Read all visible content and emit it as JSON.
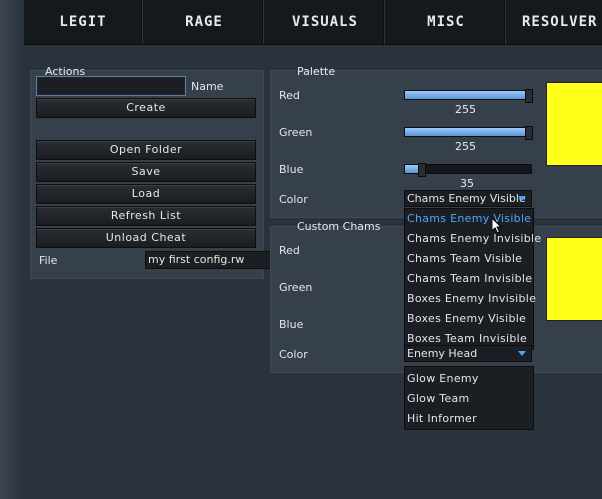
{
  "tabs": [
    "LEGIT",
    "RAGE",
    "VISUALS",
    "MISC",
    "RESOLVER"
  ],
  "actions": {
    "title": "Actions",
    "name_label": "Name",
    "name_value": "",
    "create": "Create",
    "open_folder": "Open Folder",
    "save": "Save",
    "load": "Load",
    "refresh_list": "Refresh List",
    "unload_cheat": "Unload Cheat",
    "file_label": "File",
    "file_value": "my first config.rw"
  },
  "palette": {
    "title": "Palette",
    "red_label": "Red",
    "red_value": "255",
    "red_level": 1.0,
    "green_label": "Green",
    "green_value": "255",
    "green_level": 1.0,
    "blue_label": "Blue",
    "blue_value": "35",
    "blue_level": 0.137,
    "color_label": "Color",
    "color_selected": "Chams Enemy Visible",
    "swatch_color": "#ffff1a",
    "dropdown_options": [
      "Chams Enemy Visible",
      "Chams Enemy Invisible",
      "Chams Team Visible",
      "Chams Team Invisible",
      "Boxes Enemy Invisible",
      "Boxes Enemy Visible",
      "Boxes Team Invisible",
      "Enemy Head",
      "Glow Enemy",
      "Glow Team",
      "Hit Informer"
    ]
  },
  "custom_chams": {
    "title": "Custom Chams",
    "red_label": "Red",
    "green_label": "Green",
    "blue_label": "Blue",
    "color_label": "Color",
    "color_selected": "Enemy Head",
    "swatch_color": "#ffff1a"
  },
  "colors": {
    "accent": "#4ea6ff",
    "slider_fill": "#7fb2ec",
    "swatch": "#ffff1a"
  }
}
